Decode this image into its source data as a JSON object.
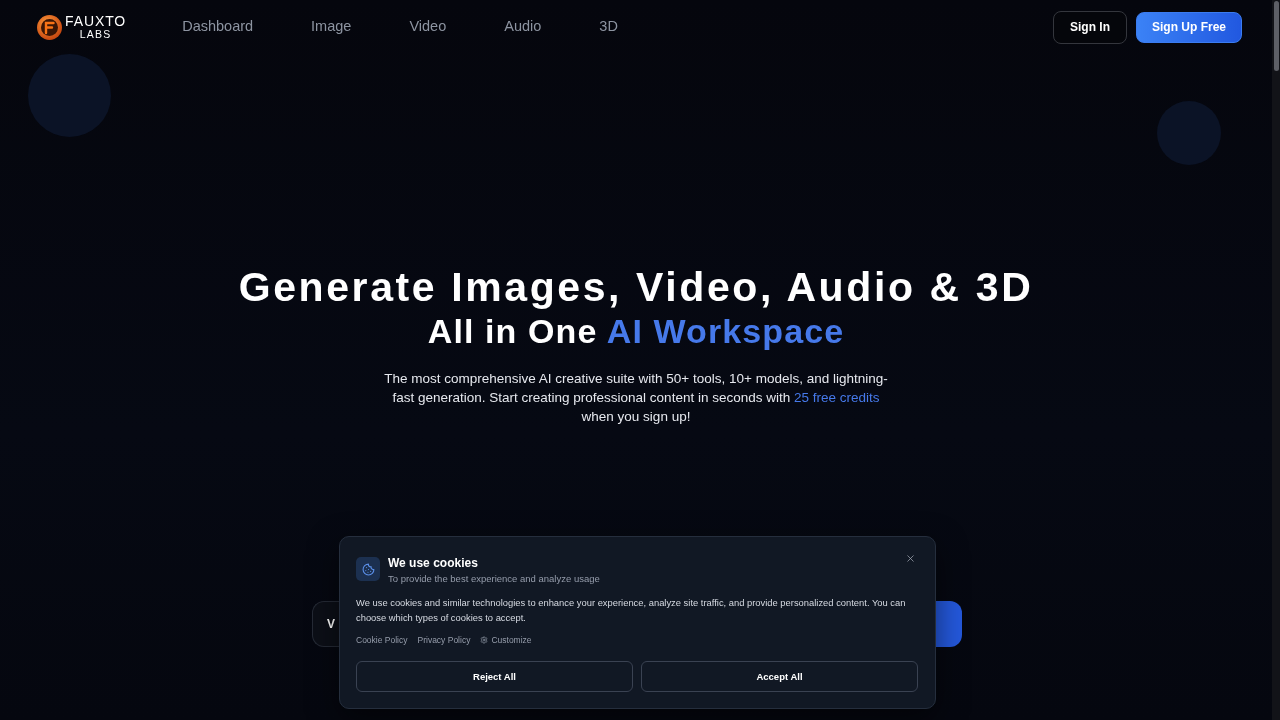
{
  "nav": {
    "logo": {
      "name": "FAUXTO",
      "tagline": "LABS"
    },
    "links": [
      {
        "label": "Dashboard",
        "selected": false
      },
      {
        "label": "Image",
        "selected": false
      },
      {
        "label": "Video",
        "selected": false
      },
      {
        "label": "Audio",
        "selected": false
      },
      {
        "label": "3D",
        "selected": false
      }
    ],
    "actions": [
      {
        "label": "Sign In",
        "kind": "outline"
      },
      {
        "label": "Sign Up Free",
        "kind": "primary"
      }
    ]
  },
  "hero": {
    "title": "Generate Images, Video, Audio & 3D",
    "subtitle": [
      {
        "text": "All in One",
        "highlighted": false
      },
      {
        "text": "AI Workspace",
        "highlighted": true
      }
    ],
    "description": [
      {
        "text": "The most comprehensive AI creative suite with 50+ tools, 10+ models, and lightning-fast generation. Start creating professional content in seconds with",
        "highlighted": false
      },
      {
        "text": "25 free credits",
        "highlighted": true
      },
      {
        "text": "when you sign up!",
        "highlighted": false
      }
    ],
    "prompt_bar": {
      "value": "V"
    }
  },
  "cookie_dialog": {
    "title": "We use cookies",
    "subtitle": "To provide the best experience and analyze usage",
    "body": "We use cookies and similar technologies to enhance your experience, analyze site traffic, and provide personalized content. You can choose which types of cookies to accept.",
    "links": [
      {
        "label": "Cookie Policy",
        "kind": "text"
      },
      {
        "label": "Privacy Policy",
        "kind": "text"
      },
      {
        "label": "Customize",
        "kind": "settings"
      }
    ],
    "buttons": [
      {
        "label": "Reject All"
      },
      {
        "label": "Accept All"
      }
    ]
  }
}
